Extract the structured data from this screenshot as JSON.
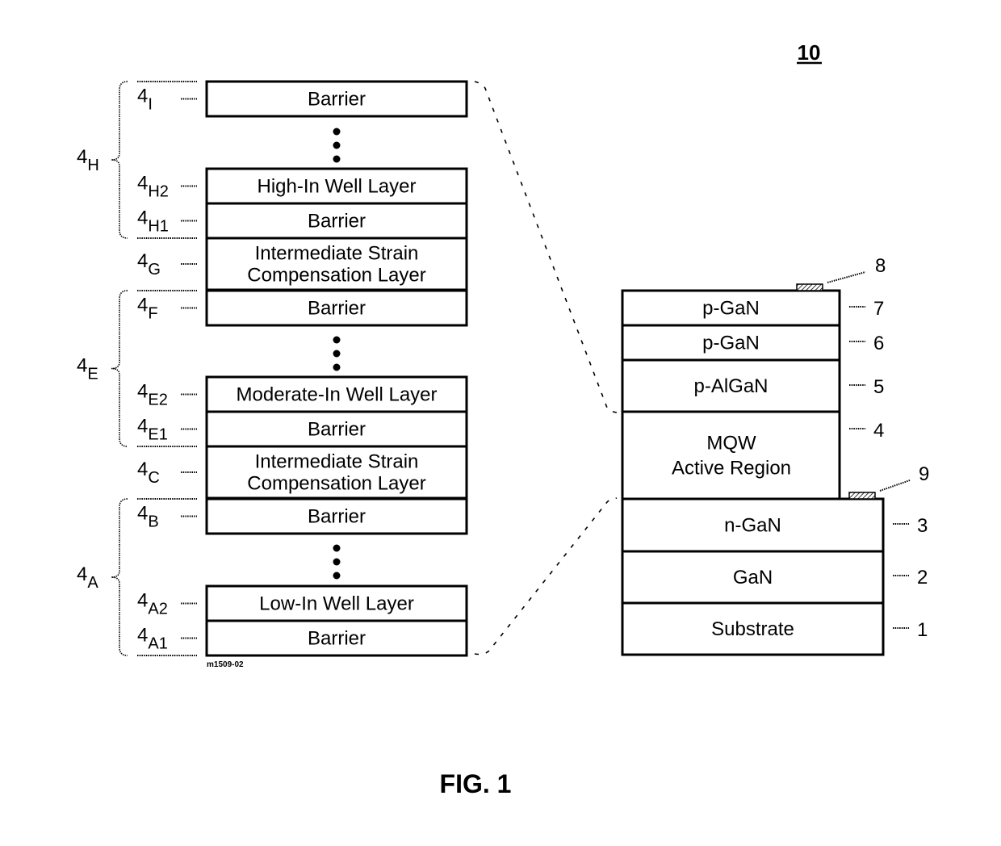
{
  "figure": {
    "title": "FIG. 1",
    "device_number": "10",
    "drawing_id": "m1509-02"
  },
  "mqw_stack": {
    "groups": [
      {
        "ref": "4",
        "sub": "H",
        "members": [
          "I",
          "H2",
          "H1"
        ]
      },
      {
        "ref": "4",
        "sub": "E",
        "members": [
          "F",
          "E2",
          "E1"
        ]
      },
      {
        "ref": "4",
        "sub": "A",
        "members": [
          "B",
          "A2",
          "A1"
        ]
      }
    ],
    "layers": [
      {
        "ref": "4",
        "sub": "I",
        "lines": [
          "Barrier"
        ]
      },
      {
        "ellipsis": true
      },
      {
        "ref": "4",
        "sub": "H2",
        "lines": [
          "High-In Well Layer"
        ]
      },
      {
        "ref": "4",
        "sub": "H1",
        "lines": [
          "Barrier"
        ]
      },
      {
        "ref": "4",
        "sub": "G",
        "lines": [
          "Intermediate Strain",
          "Compensation Layer"
        ]
      },
      {
        "ref": "4",
        "sub": "F",
        "lines": [
          "Barrier"
        ]
      },
      {
        "ellipsis": true
      },
      {
        "ref": "4",
        "sub": "E2",
        "lines": [
          "Moderate-In Well Layer"
        ]
      },
      {
        "ref": "4",
        "sub": "E1",
        "lines": [
          "Barrier"
        ]
      },
      {
        "ref": "4",
        "sub": "C",
        "lines": [
          "Intermediate Strain",
          "Compensation Layer"
        ]
      },
      {
        "ref": "4",
        "sub": "B",
        "lines": [
          "Barrier"
        ]
      },
      {
        "ellipsis": true
      },
      {
        "ref": "4",
        "sub": "A2",
        "lines": [
          "Low-In Well Layer"
        ]
      },
      {
        "ref": "4",
        "sub": "A1",
        "lines": [
          "Barrier"
        ]
      }
    ]
  },
  "device_stack": {
    "layers": [
      {
        "ref": "7",
        "lines": [
          "p-GaN"
        ]
      },
      {
        "ref": "6",
        "lines": [
          "p-GaN"
        ]
      },
      {
        "ref": "5",
        "lines": [
          "p-AlGaN"
        ]
      },
      {
        "ref": "4",
        "lines": [
          "MQW",
          "Active Region"
        ]
      },
      {
        "ref": "3",
        "lines": [
          "n-GaN"
        ]
      },
      {
        "ref": "2",
        "lines": [
          "GaN"
        ]
      },
      {
        "ref": "1",
        "lines": [
          "Substrate"
        ]
      }
    ],
    "contacts": [
      {
        "ref": "8",
        "label": "p-contact"
      },
      {
        "ref": "9",
        "label": "n-contact"
      }
    ]
  }
}
